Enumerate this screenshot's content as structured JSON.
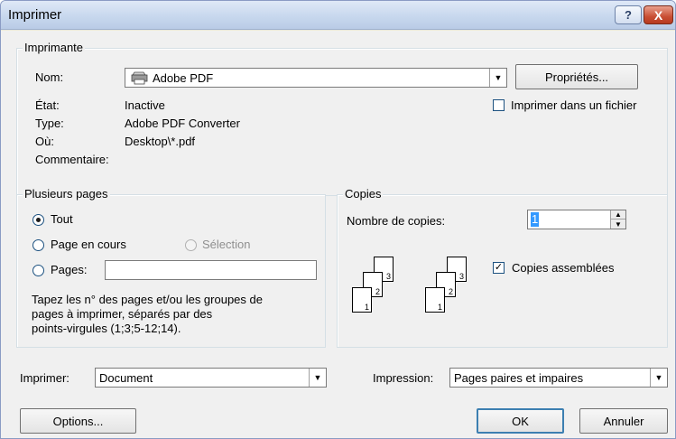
{
  "window": {
    "title": "Imprimer",
    "help_glyph": "?",
    "close_glyph": "X"
  },
  "printer": {
    "legend": "Imprimante",
    "name_label": "Nom:",
    "name_value": "Adobe PDF",
    "properties_button": "Propriétés...",
    "state_label": "État:",
    "state_value": "Inactive",
    "type_label": "Type:",
    "type_value": "Adobe PDF Converter",
    "where_label": "Où:",
    "where_value": "Desktop\\*.pdf",
    "comment_label": "Commentaire:",
    "print_to_file_label": "Imprimer dans un fichier"
  },
  "pages": {
    "legend": "Plusieurs pages",
    "all_label": "Tout",
    "current_label": "Page en cours",
    "selection_label": "Sélection",
    "pages_label": "Pages:",
    "pages_value": "",
    "help_line1": "Tapez les n° des pages et/ou les groupes de",
    "help_line2": "pages à imprimer, séparés par des",
    "help_line3": "points-virgules (1;3;5-12;14)."
  },
  "copies": {
    "legend": "Copies",
    "count_label": "Nombre de copies:",
    "count_value": "1",
    "collate_label": "Copies assemblées",
    "collate_checked": true
  },
  "print_what": {
    "label": "Imprimer:",
    "value": "Document"
  },
  "impression": {
    "label": "Impression:",
    "value": "Pages paires et impaires"
  },
  "buttons": {
    "options": "Options...",
    "ok": "OK",
    "cancel": "Annuler"
  },
  "colors": {
    "accent": "#3399ff",
    "default_button_border": "#3c7fb1"
  },
  "icons": {
    "printer": "printer-icon",
    "dropdown": "chevron-down-icon"
  }
}
